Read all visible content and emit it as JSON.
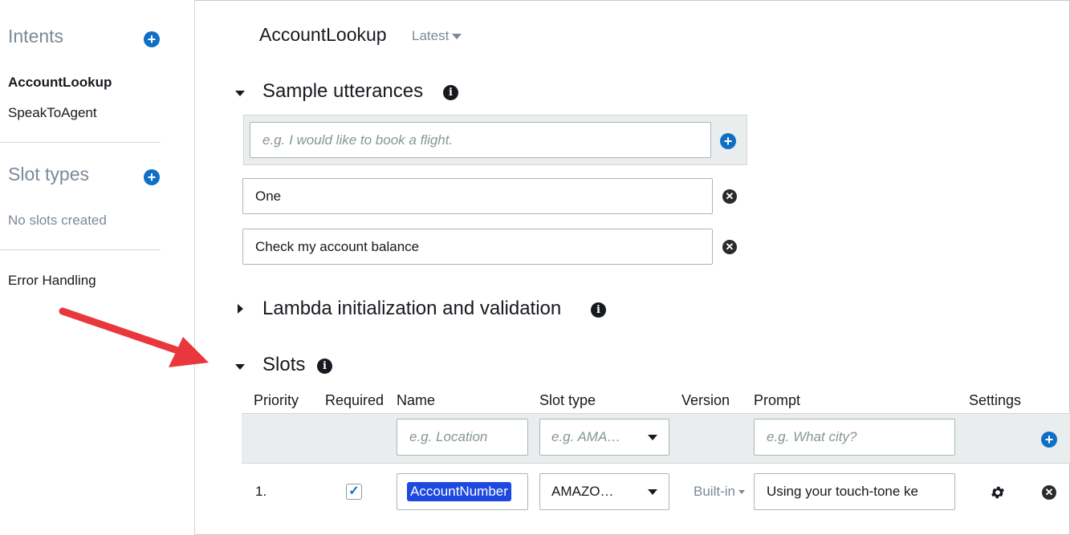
{
  "sidebar": {
    "intents_heading": "Intents",
    "intents": [
      {
        "label": "AccountLookup",
        "active": true
      },
      {
        "label": "SpeakToAgent",
        "active": false
      }
    ],
    "slot_types_heading": "Slot types",
    "no_slots_text": "No slots created",
    "error_handling": "Error Handling"
  },
  "header": {
    "intent_name": "AccountLookup",
    "version": "Latest"
  },
  "sample_utterances": {
    "title": "Sample utterances",
    "placeholder": "e.g. I would like to book a flight.",
    "items": [
      "One",
      "Check my account balance"
    ]
  },
  "lambda": {
    "title": "Lambda initialization and validation"
  },
  "slots": {
    "title": "Slots",
    "columns": [
      "Priority",
      "Required",
      "Name",
      "Slot type",
      "Version",
      "Prompt",
      "Settings"
    ],
    "new_row": {
      "name_placeholder": "e.g. Location",
      "type_placeholder": "e.g. AMA…",
      "prompt_placeholder": "e.g. What city?"
    },
    "rows": [
      {
        "priority": "1.",
        "required": true,
        "name": "AccountNumber",
        "slot_type": "AMAZO…",
        "version": "Built-in",
        "prompt": "Using your touch-tone ke"
      }
    ]
  },
  "colors": {
    "accent_blue": "#0f6fc6",
    "annotation_arrow": "#e8383d",
    "selection": "#1d49e0"
  }
}
